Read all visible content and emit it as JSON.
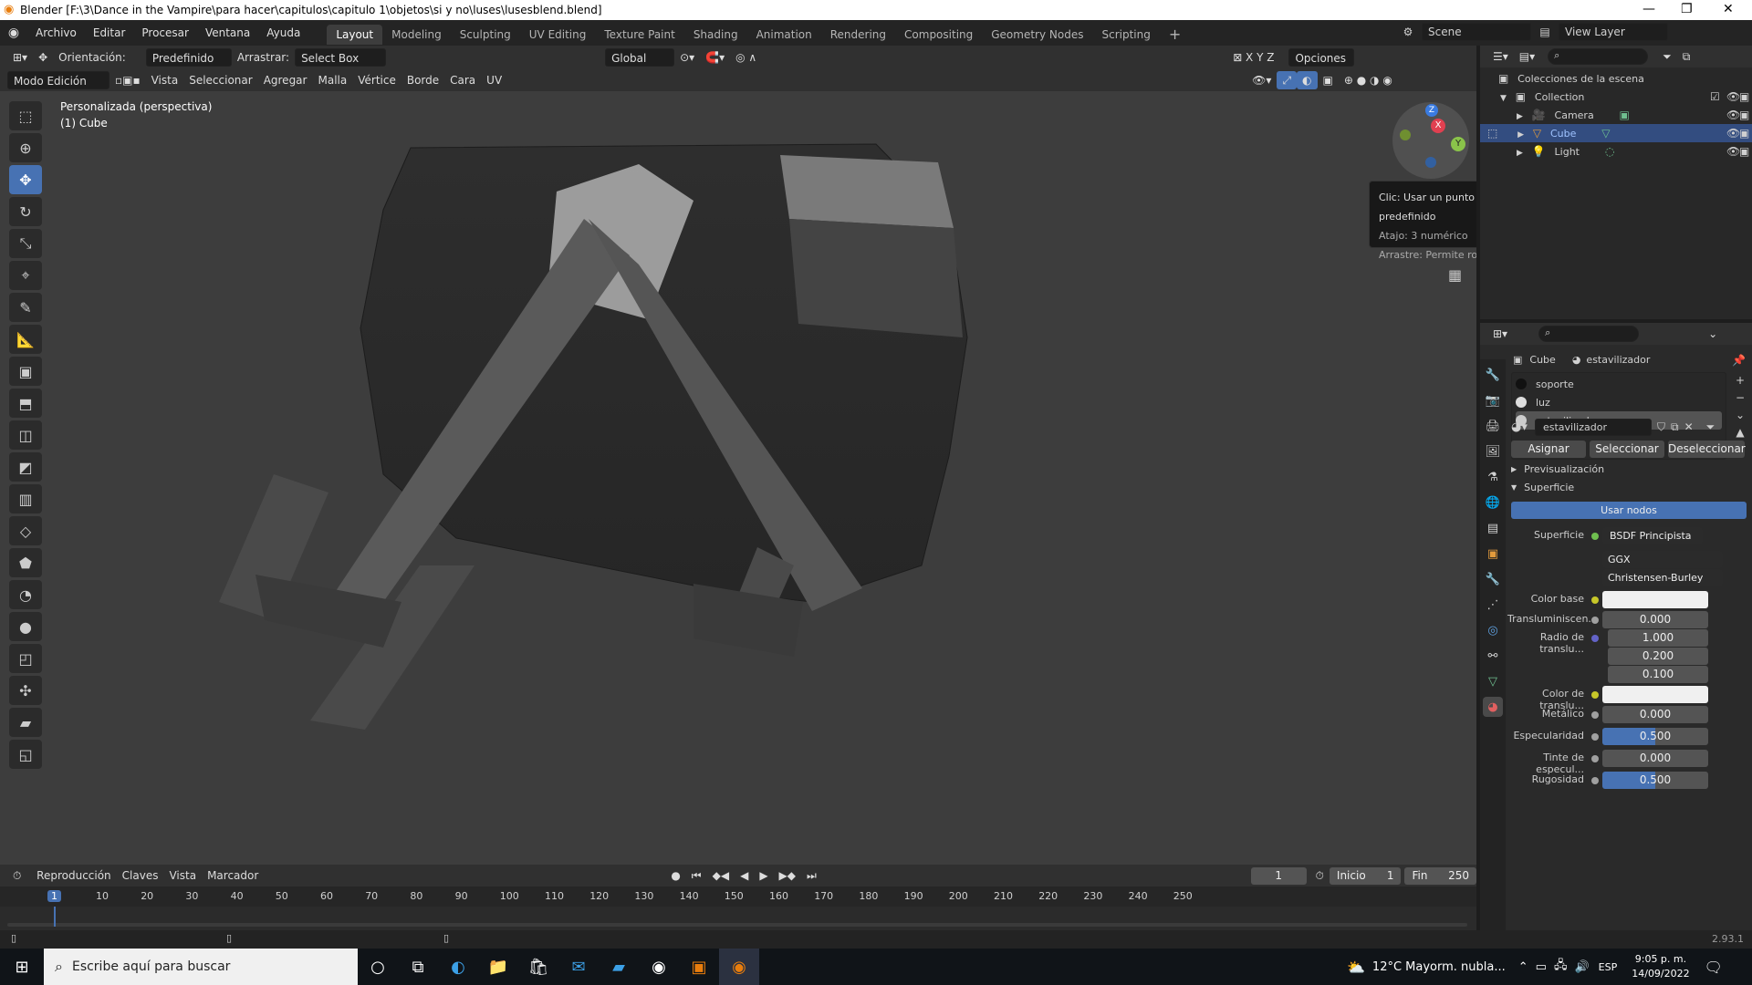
{
  "window": {
    "title": "Blender [F:\\3\\Dance in the Vampire\\para hacer\\capitulos\\capitulo 1\\objetos\\si y no\\luses\\lusesblend.blend]"
  },
  "menu": [
    "Archivo",
    "Editar",
    "Procesar",
    "Ventana",
    "Ayuda"
  ],
  "workspaces": [
    "Layout",
    "Modeling",
    "Sculpting",
    "UV Editing",
    "Texture Paint",
    "Shading",
    "Animation",
    "Rendering",
    "Compositing",
    "Geometry Nodes",
    "Scripting"
  ],
  "scene": {
    "name": "Scene",
    "view_layer": "View Layer"
  },
  "header": {
    "orientation_label": "Orientación:",
    "orientation_value": "Predefinido",
    "drag_label": "Arrastrar:",
    "drag_value": "Select Box",
    "transform_orientation": "Global",
    "options": "Opciones",
    "mode": "Modo Edición",
    "menus": [
      "Vista",
      "Seleccionar",
      "Agregar",
      "Malla",
      "Vértice",
      "Borde",
      "Cara",
      "UV"
    ]
  },
  "viewport": {
    "view_name": "Personalizada (perspectiva)",
    "object_name": "(1) Cube",
    "tooltip": [
      "Clic: Usar un punto de vista predefinido",
      "Atajo: 3 numérico",
      "Arrastre: Permite rotar la vista"
    ],
    "gizmo_axes": [
      "X",
      "Y",
      "Z"
    ]
  },
  "outliner": {
    "title": "Colecciones de la escena",
    "collection": "Collection",
    "items": [
      {
        "name": "Camera",
        "selected": false
      },
      {
        "name": "Cube",
        "selected": true
      },
      {
        "name": "Light",
        "selected": false
      }
    ]
  },
  "properties": {
    "breadcrumb_object": "Cube",
    "breadcrumb_material": "estavilizador",
    "slots": [
      "soporte",
      "luz",
      "estavilizador"
    ],
    "active_slot": "estavilizador",
    "material_name": "estavilizador",
    "buttons": {
      "assign": "Asignar",
      "select": "Seleccionar",
      "deselect": "Deseleccionar"
    },
    "sections": {
      "preview": "Previsualización",
      "surface": "Superficie"
    },
    "use_nodes": "Usar nodos",
    "surface_label": "Superficie",
    "surface_value": "BSDF Principista",
    "distribution": "GGX",
    "subsurface_method": "Christensen-Burley",
    "fields": {
      "color_base_label": "Color base",
      "transluminiscence_label": "Transluminiscen...",
      "transluminiscence_value": "0.000",
      "radio_label": "Radio de translu...",
      "radio_values": [
        "1.000",
        "0.200",
        "0.100"
      ],
      "color_translu_label": "Color de translu...",
      "metalico_label": "Metálico",
      "metalico_value": "0.000",
      "especularidad_label": "Especularidad",
      "especularidad_value": "0.500",
      "tinte_label": "Tinte de especul...",
      "tinte_value": "0.000",
      "rugosidad_label": "Rugosidad",
      "rugosidad_value": "0.500"
    }
  },
  "timeline": {
    "menus": [
      "Reproducción",
      "Claves",
      "Vista",
      "Marcador"
    ],
    "current_frame": "1",
    "start_label": "Inicio",
    "start": "1",
    "end_label": "Fin",
    "end": "250",
    "ticks": [
      "1",
      "10",
      "20",
      "30",
      "40",
      "50",
      "60",
      "70",
      "80",
      "90",
      "100",
      "110",
      "120",
      "130",
      "140",
      "150",
      "160",
      "170",
      "180",
      "190",
      "200",
      "210",
      "220",
      "230",
      "240",
      "250"
    ]
  },
  "status": {
    "version": "2.93.1"
  },
  "taskbar": {
    "search_placeholder": "Escribe aquí para buscar",
    "weather": "12°C  Mayorm. nubla...",
    "lang": "ESP",
    "time": "9:05 p. m.",
    "date": "14/09/2022"
  },
  "colors": {
    "accent": "#4772b3",
    "selected_row": "#334d80",
    "viewport_bg": "#3d3d3d"
  }
}
